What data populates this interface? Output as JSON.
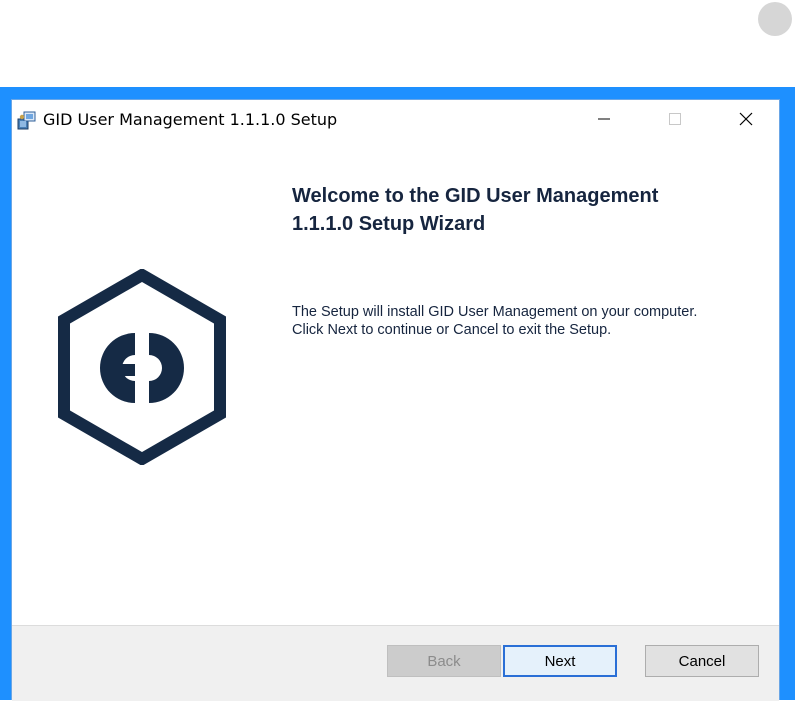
{
  "window": {
    "title": "GID User Management 1.1.1.0 Setup",
    "controls": {
      "minimize": "—",
      "maximize": "☐",
      "close": "✕"
    }
  },
  "wizard": {
    "heading_line1": "Welcome to the GID User Management",
    "heading_line2": "1.1.1.0 Setup Wizard",
    "description_line1": "The Setup will install GID User Management on your computer.",
    "description_line2": "Click Next to continue or Cancel to exit the Setup."
  },
  "buttons": {
    "back_label": "Back",
    "back_enabled": false,
    "next_label": "Next",
    "cancel_label": "Cancel"
  },
  "colors": {
    "desktop_blue": "#1e90ff",
    "heading_navy": "#16253f",
    "logo_navy": "#152a45",
    "focus_blue": "#2a6fd6"
  },
  "icons": {
    "title": "installer-icon",
    "logo": "gid-hexagon-logo"
  }
}
